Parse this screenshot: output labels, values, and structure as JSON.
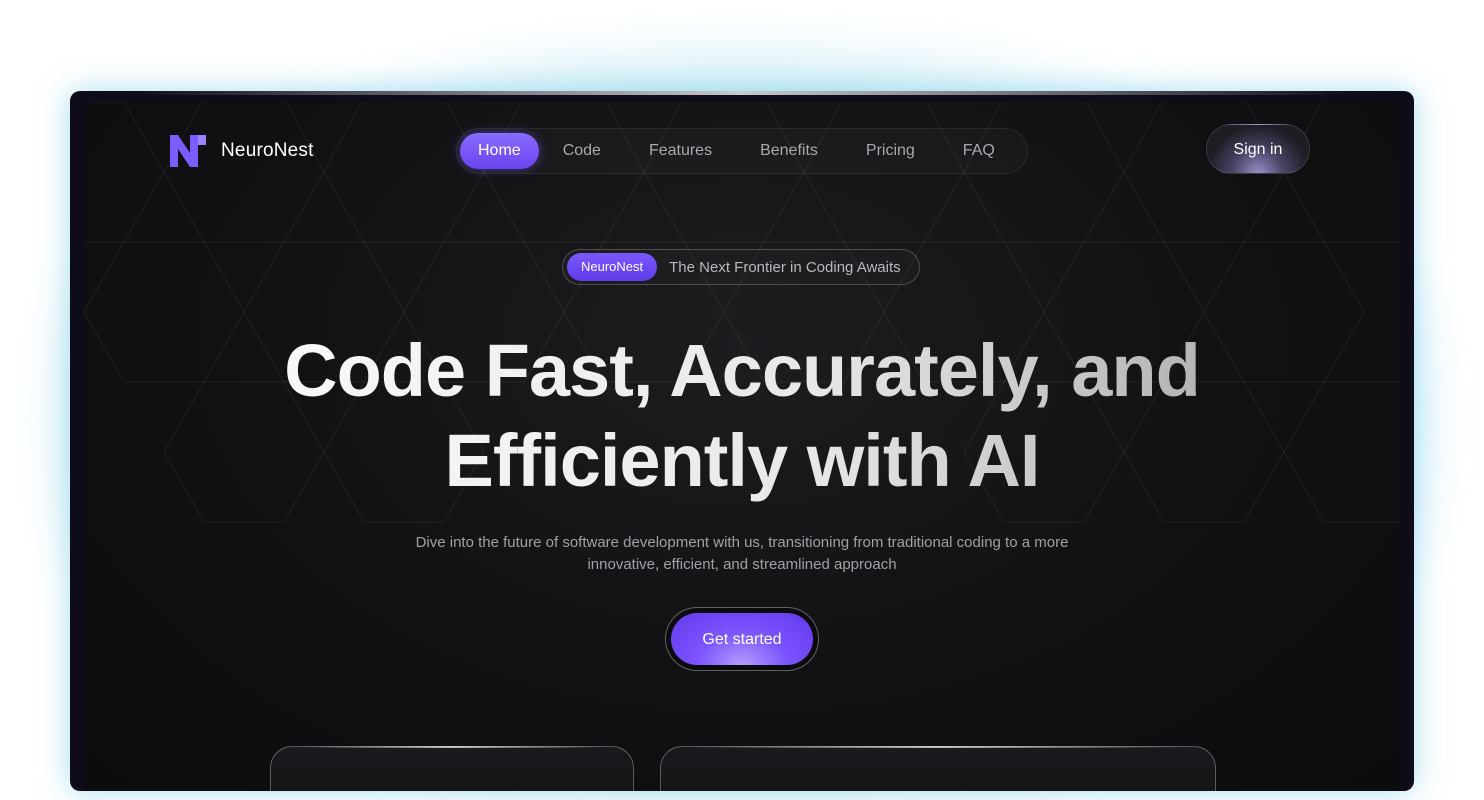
{
  "brand": {
    "name": "NeuroNest",
    "accent": "#6a43f0"
  },
  "nav": {
    "items": [
      {
        "label": "Home",
        "active": true
      },
      {
        "label": "Code",
        "active": false
      },
      {
        "label": "Features",
        "active": false
      },
      {
        "label": "Benefits",
        "active": false
      },
      {
        "label": "Pricing",
        "active": false
      },
      {
        "label": "FAQ",
        "active": false
      }
    ],
    "signin_label": "Sign in"
  },
  "badge": {
    "pill": "NeuroNest",
    "text": "The Next Frontier in Coding Awaits"
  },
  "hero": {
    "headline_line1": "Code Fast, Accurately, and",
    "headline_line2": "Efficiently with AI",
    "sub_line1": "Dive into the future of software development with us, transitioning from traditional coding to a more",
    "sub_line2": "innovative, efficient, and streamlined approach",
    "cta_label": "Get started"
  }
}
